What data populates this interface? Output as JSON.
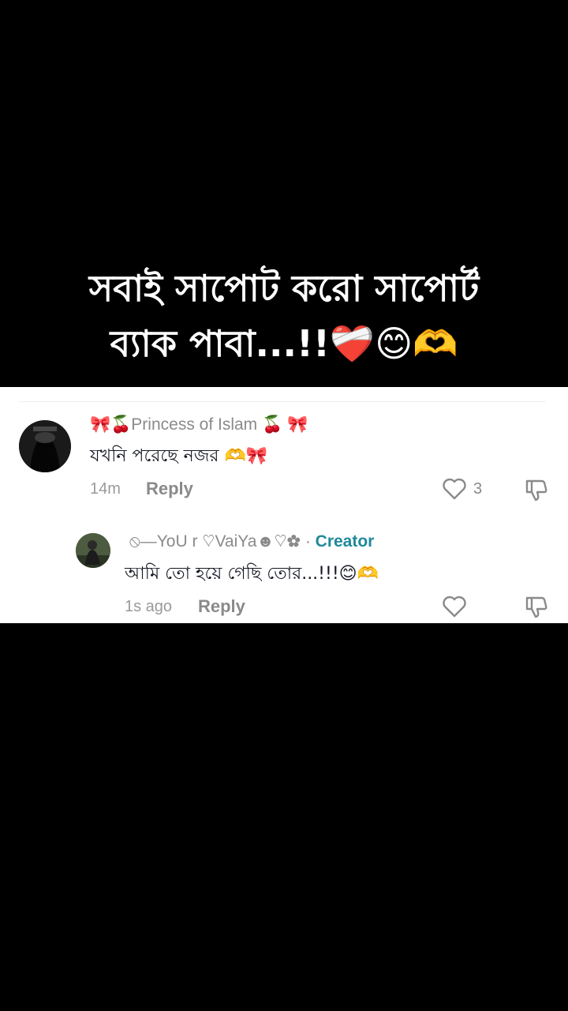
{
  "caption": {
    "line1": "সবাই সাপোট করো সাপোর্ট",
    "line2": "ব্যাক পাবা...!!❤️‍🩹😊🫶"
  },
  "comments": [
    {
      "username": "🎀🍒Princess of Islam 🍒 🎀",
      "text": "যখনি পরেছে নজর 🫶🎀",
      "time": "14m",
      "reply_label": "Reply",
      "likes": "3",
      "avatar_icon": "avatar-hijab-icon"
    },
    {
      "username": "⦸—YoU r ♡VaiYa☻♡✿",
      "separator": " · ",
      "badge": "Creator",
      "text": "আমি তো হয়ে গেছি তোর...!!!😊🫶",
      "time": "1s ago",
      "reply_label": "Reply",
      "likes": "",
      "avatar_icon": "avatar-boy-icon"
    }
  ],
  "colors": {
    "background": "#000000",
    "panel": "#ffffff",
    "creator_badge": "#1f8a9a",
    "muted": "#8a8a8a"
  }
}
